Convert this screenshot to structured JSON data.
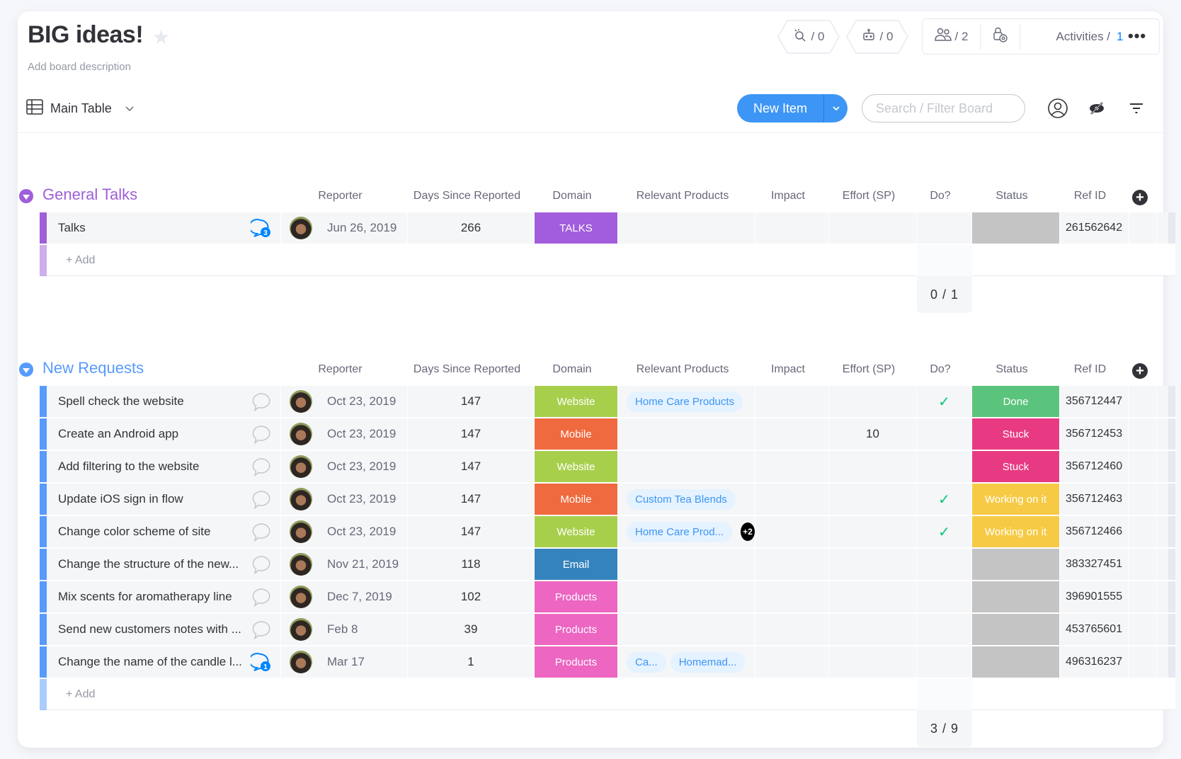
{
  "board": {
    "title": "BIG ideas!",
    "description": "Add board description",
    "integrations_count": "/ 0",
    "automations_count": "/ 0",
    "members_count": "/ 2",
    "activities_label": "Activities /",
    "activities_count": "1",
    "more_label": "•••"
  },
  "toolbar": {
    "view_label": "Main Table",
    "new_item_label": "New Item",
    "search_placeholder": "Search / Filter Board"
  },
  "columns": [
    "Reporter",
    "Days Since Reported",
    "Domain",
    "Relevant Products",
    "Impact",
    "Effort (SP)",
    "Do?",
    "Status",
    "Ref ID"
  ],
  "colors": {
    "general_talks": "#a25ddc",
    "new_requests": "#579bfc",
    "talks_domain": "#a25ddc",
    "website": "#9cd326",
    "mobile": "#ff642e",
    "email": "#1e7bc4",
    "products": "#ff5ac4",
    "done": "#00c875",
    "stuck": "#e2445c",
    "working": "#fdab3d",
    "empty_status": "#c4c4c4"
  },
  "groups": [
    {
      "title": "General Talks",
      "add_label": "+ Add",
      "summary": "0 / 1",
      "items": [
        {
          "name": "Talks",
          "comments": "3",
          "date": "Jun 26, 2019",
          "days": "266",
          "domain": "TALKS",
          "products": [],
          "products_more": "",
          "impact": "",
          "effort": "",
          "do": "",
          "status": "",
          "ref": "261562642"
        }
      ]
    },
    {
      "title": "New Requests",
      "add_label": "+ Add",
      "summary": "3 / 9",
      "items": [
        {
          "name": "Spell check the website",
          "comments": "",
          "date": "Oct 23, 2019",
          "days": "147",
          "domain": "Website",
          "products": [
            "Home Care Products"
          ],
          "products_more": "",
          "impact": "",
          "effort": "",
          "do": "✓",
          "status": "Done",
          "ref": "356712447"
        },
        {
          "name": "Create an Android app",
          "comments": "",
          "date": "Oct 23, 2019",
          "days": "147",
          "domain": "Mobile",
          "products": [],
          "products_more": "",
          "impact": "",
          "effort": "10",
          "do": "",
          "status": "Stuck",
          "ref": "356712453"
        },
        {
          "name": "Add filtering to the website",
          "comments": "",
          "date": "Oct 23, 2019",
          "days": "147",
          "domain": "Website",
          "products": [],
          "products_more": "",
          "impact": "",
          "effort": "",
          "do": "",
          "status": "Stuck",
          "ref": "356712460"
        },
        {
          "name": "Update iOS sign in flow",
          "comments": "",
          "date": "Oct 23, 2019",
          "days": "147",
          "domain": "Mobile",
          "products": [
            "Custom Tea Blends"
          ],
          "products_more": "",
          "impact": "",
          "effort": "",
          "do": "✓",
          "status": "Working on it",
          "ref": "356712463"
        },
        {
          "name": "Change color scheme of site",
          "comments": "",
          "date": "Oct 23, 2019",
          "days": "147",
          "domain": "Website",
          "products": [
            "Home Care Prod..."
          ],
          "products_more": "+2",
          "impact": "",
          "effort": "",
          "do": "✓",
          "status": "Working on it",
          "ref": "356712466"
        },
        {
          "name": "Change the structure of the new...",
          "comments": "",
          "date": "Nov 21, 2019",
          "days": "118",
          "domain": "Email",
          "products": [],
          "products_more": "",
          "impact": "",
          "effort": "",
          "do": "",
          "status": "",
          "ref": "383327451"
        },
        {
          "name": "Mix scents for aromatherapy line",
          "comments": "",
          "date": "Dec 7, 2019",
          "days": "102",
          "domain": "Products",
          "products": [],
          "products_more": "",
          "impact": "",
          "effort": "",
          "do": "",
          "status": "",
          "ref": "396901555"
        },
        {
          "name": "Send new customers notes with ...",
          "comments": "",
          "date": "Feb 8",
          "days": "39",
          "domain": "Products",
          "products": [],
          "products_more": "",
          "impact": "",
          "effort": "",
          "do": "",
          "status": "",
          "ref": "453765601"
        },
        {
          "name": "Change the name of the candle l...",
          "comments": "1",
          "date": "Mar 17",
          "days": "1",
          "domain": "Products",
          "products": [
            "Ca...",
            "Homemad..."
          ],
          "products_more": "",
          "impact": "",
          "effort": "",
          "do": "",
          "status": "",
          "ref": "496316237"
        }
      ]
    }
  ]
}
